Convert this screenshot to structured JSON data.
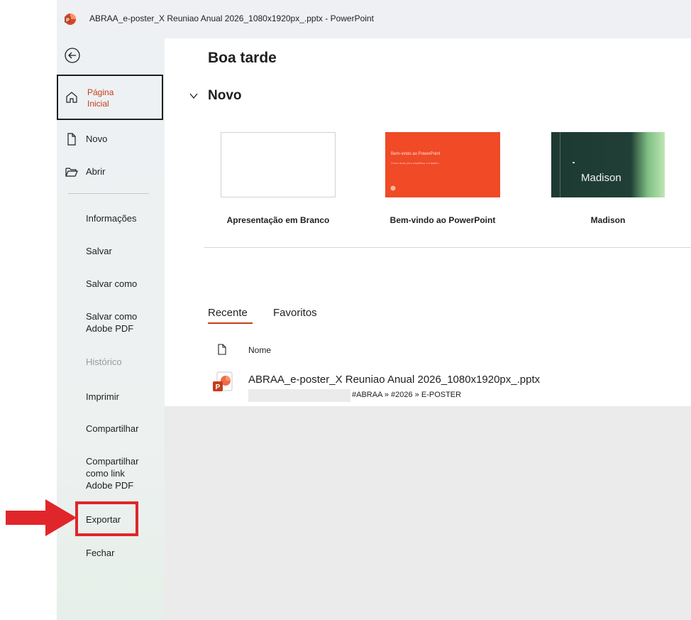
{
  "window": {
    "title": "ABRAA_e-poster_X Reuniao Anual 2026_1080x1920px_.pptx  -  PowerPoint",
    "app_icon": "powerpoint-logo-icon",
    "accent_color": "#c43e1c"
  },
  "sidebar": {
    "back_icon": "back-arrow-icon",
    "home": {
      "label": "Página Inicial",
      "icon": "home-icon"
    },
    "new": {
      "label": "Novo",
      "icon": "new-document-icon"
    },
    "open": {
      "label": "Abrir",
      "icon": "open-folder-icon"
    },
    "items": [
      {
        "label": "Informações",
        "enabled": true
      },
      {
        "label": "Salvar",
        "enabled": true
      },
      {
        "label": "Salvar como",
        "enabled": true
      },
      {
        "label": "Salvar como Adobe PDF",
        "enabled": true
      },
      {
        "label": "Histórico",
        "enabled": false
      },
      {
        "label": "Imprimir",
        "enabled": true
      },
      {
        "label": "Compartilhar",
        "enabled": true
      },
      {
        "label": "Compartilhar como link Adobe PDF",
        "enabled": true
      },
      {
        "label": "Exportar",
        "enabled": true,
        "highlighted": true
      },
      {
        "label": "Fechar",
        "enabled": true
      }
    ],
    "highlight_color": "#e0262a"
  },
  "main": {
    "greeting": "Boa tarde",
    "new_section": {
      "title": "Novo",
      "templates": [
        {
          "label": "Apresentação em Branco"
        },
        {
          "label": "Bem-vindo ao PowerPoint",
          "thumb_title": "Bem-vindo ao PowerPoint",
          "thumb_subtitle": "Cinco dicas para simplificar o trabalho",
          "thumb_color": "#f04a26"
        },
        {
          "label": "Madison",
          "thumb_word": "Madison"
        }
      ]
    },
    "tabs": [
      {
        "label": "Recente",
        "active": true
      },
      {
        "label": "Favoritos",
        "active": false
      }
    ],
    "list": {
      "column_name": "Nome",
      "files": [
        {
          "name": "ABRAA_e-poster_X Reuniao Anual 2026_1080x1920px_.pptx",
          "path": "#ABRAA » #2026 » E-POSTER",
          "icon": "pptx-file-icon"
        }
      ]
    }
  }
}
